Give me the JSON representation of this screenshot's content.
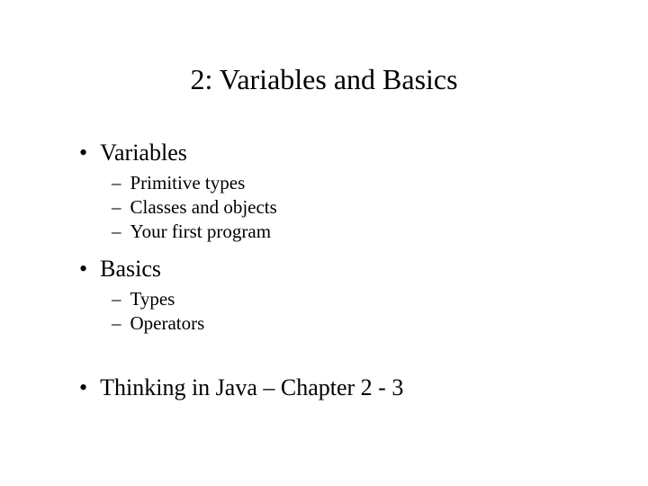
{
  "title": "2: Variables and Basics",
  "sections": {
    "variables": {
      "label": "Variables",
      "items": {
        "primitive": "Primitive types",
        "classes": "Classes and objects",
        "first_program": "Your first program"
      }
    },
    "basics": {
      "label": "Basics",
      "items": {
        "types": "Types",
        "operators": "Operators"
      }
    },
    "reference": {
      "label": "Thinking in Java – Chapter 2 - 3"
    }
  }
}
